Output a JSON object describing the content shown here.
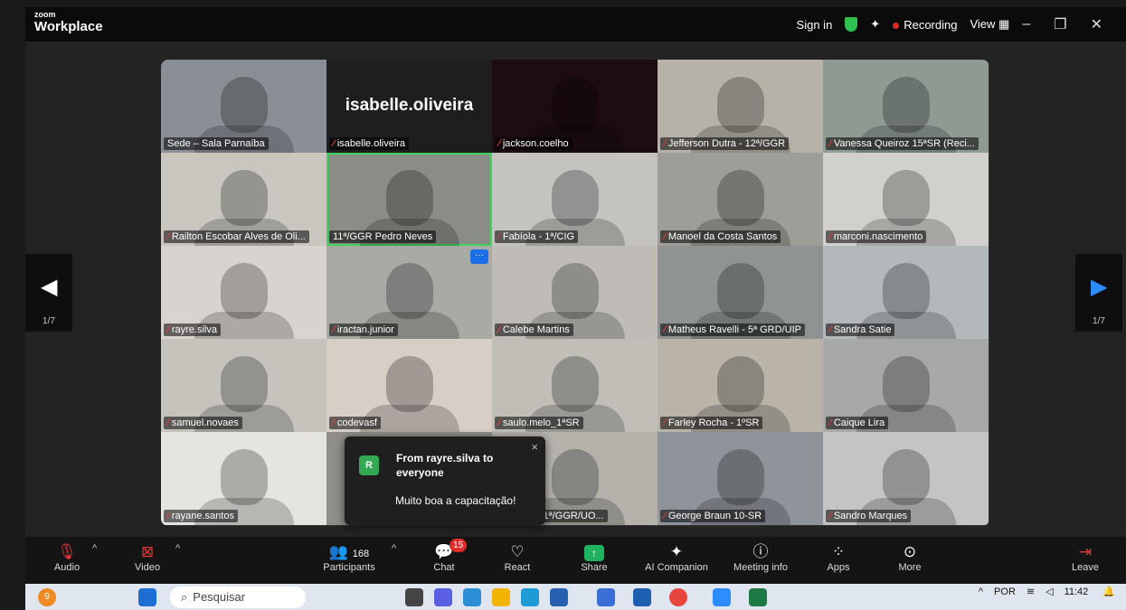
{
  "app": {
    "logo_small": "zoom",
    "logo_big": "Workplace"
  },
  "header": {
    "sign_in": "Sign in",
    "recording": "Recording",
    "view": "View"
  },
  "pager": {
    "left": "1/7",
    "right": "1/7"
  },
  "tiles": [
    {
      "name": "Sede – Sala Parnaíba",
      "muted": false,
      "color": "#8a8f96"
    },
    {
      "name": "isabelle.oliveira",
      "muted": true,
      "color": "#1e1e1e",
      "big": "isabelle.oliveira"
    },
    {
      "name": "jackson.coelho",
      "muted": true,
      "color": "#1d0d10"
    },
    {
      "name": "Jefferson Dutra - 12ª/GGR",
      "muted": true,
      "color": "#b7b2a8"
    },
    {
      "name": "Vanessa Queiroz 15ªSR (Reci...",
      "muted": true,
      "color": "#8f9a93"
    },
    {
      "name": "Railton Escobar Alves de Oli...",
      "muted": true,
      "color": "#c9c6c0"
    },
    {
      "name": "11ª/GGR Pedro Neves",
      "muted": false,
      "color": "#8a8c86",
      "active": true
    },
    {
      "name": "Fabíola - 1ª/CIG",
      "muted": true,
      "color": "#c4c3c0"
    },
    {
      "name": "Manoel da Costa Santos",
      "muted": true,
      "color": "#9f9d97"
    },
    {
      "name": "marconi.nascimento",
      "muted": true,
      "color": "#d2d0cc"
    },
    {
      "name": "rayre.silva",
      "muted": true,
      "color": "#d9d3cf"
    },
    {
      "name": "iractan.junior",
      "muted": true,
      "color": "#a9aaa6",
      "more": "···"
    },
    {
      "name": "Calebe Martins",
      "muted": true,
      "color": "#bfbcb7"
    },
    {
      "name": "Matheus Ravelli - 5ª GRD/UIP",
      "muted": true,
      "color": "#8f9394"
    },
    {
      "name": "Sandra Satie",
      "muted": true,
      "color": "#b3b8bb"
    },
    {
      "name": "samuel.novaes",
      "muted": true,
      "color": "#c6c3bd"
    },
    {
      "name": "codevasf",
      "muted": true,
      "color": "#d7cec6"
    },
    {
      "name": "saulo.melo_1ªSR",
      "muted": true,
      "color": "#c1beb8"
    },
    {
      "name": "Farley Rocha - 1ºSR",
      "muted": true,
      "color": "#b9b3a8"
    },
    {
      "name": "Caique Lira",
      "muted": true,
      "color": "#a7a9a6"
    },
    {
      "name": "rayane.santos",
      "muted": true,
      "color": "#e6e4e0"
    },
    {
      "name": "",
      "muted": true,
      "color": "#8e8d89"
    },
    {
      "name": "z L Silva 11ª/GGR/UO...",
      "muted": false,
      "color": "#b5b2ac"
    },
    {
      "name": "George Braun 10-SR",
      "muted": true,
      "color": "#8f939a"
    },
    {
      "name": "Sandro Marques",
      "muted": true,
      "color": "#c2c5c2"
    }
  ],
  "toast": {
    "avatar": "R",
    "from": "From rayre.silva to everyone",
    "message": "Muito boa a capacitação!",
    "close": "×"
  },
  "toolbar": {
    "audio": "Audio",
    "video": "Video",
    "participants": "Participants",
    "participants_count": "168",
    "chat": "Chat",
    "chat_badge": "15",
    "react": "React",
    "share": "Share",
    "ai": "AI Companion",
    "meeting_info": "Meeting info",
    "apps": "Apps",
    "more": "More",
    "leave": "Leave"
  },
  "taskbar": {
    "search": "Pesquisar",
    "notif": "9",
    "lang": "POR",
    "time": "11:42"
  }
}
